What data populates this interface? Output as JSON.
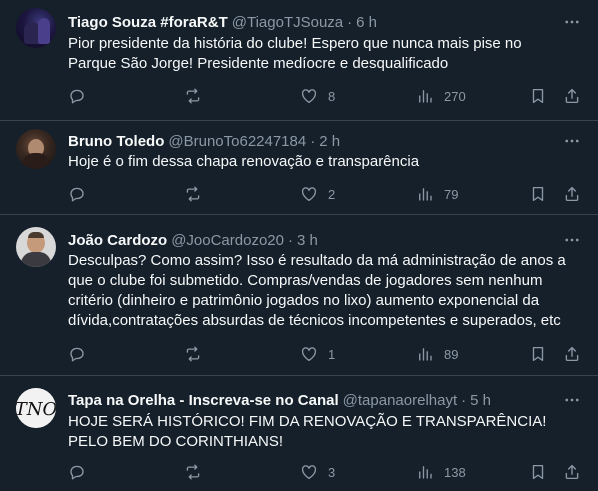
{
  "colors": {
    "background": "#15202b",
    "text": "#f7f9f9",
    "secondary_text": "#8b98a5",
    "divider": "#38444d"
  },
  "tweets": [
    {
      "name": "Tiago Souza #foraR&T",
      "handle": "@TiagoTJSouza",
      "separator": "·",
      "time": "6 h",
      "text": "Pior presidente da história do clube! Espero que nunca mais pise no Parque São Jorge! Presidente medíocre e desqualificado",
      "likes": "8",
      "views": "270",
      "avatar": "avatar-photo-dark-purple"
    },
    {
      "name": "Bruno Toledo",
      "handle": "@BrunoTo62247184",
      "separator": "·",
      "time": "2 h",
      "text": "Hoje é o fim dessa chapa renovação e transparência",
      "likes": "2",
      "views": "79",
      "avatar": "avatar-photo-dark-portrait"
    },
    {
      "name": "João Cardozo",
      "handle": "@JooCardozo20",
      "separator": "·",
      "time": "3 h",
      "text": "Desculpas? Como assim? Isso é  resultado da má administração de anos a que o clube foi submetido. Compras/vendas de jogadores sem nenhum critério (dinheiro e patrimônio jogados no lixo) aumento exponencial da dívida,contratações absurdas de técnicos incompetentes e superados, etc",
      "likes": "1",
      "views": "89",
      "avatar": "avatar-photo-man-light-background"
    },
    {
      "name": "Tapa na Orelha - Inscreva-se no Canal",
      "handle": "@tapanaorelhayt",
      "separator": "·",
      "time": "5 h",
      "text": "HOJE SERÁ HISTÓRICO! FIM DA RENOVAÇÃO E TRANSPARÊNCIA! PELO BEM DO CORINTHIANS!",
      "likes": "3",
      "views": "138",
      "avatar": "avatar-logo-tno-monogram",
      "logo_text": "TNO"
    }
  ]
}
